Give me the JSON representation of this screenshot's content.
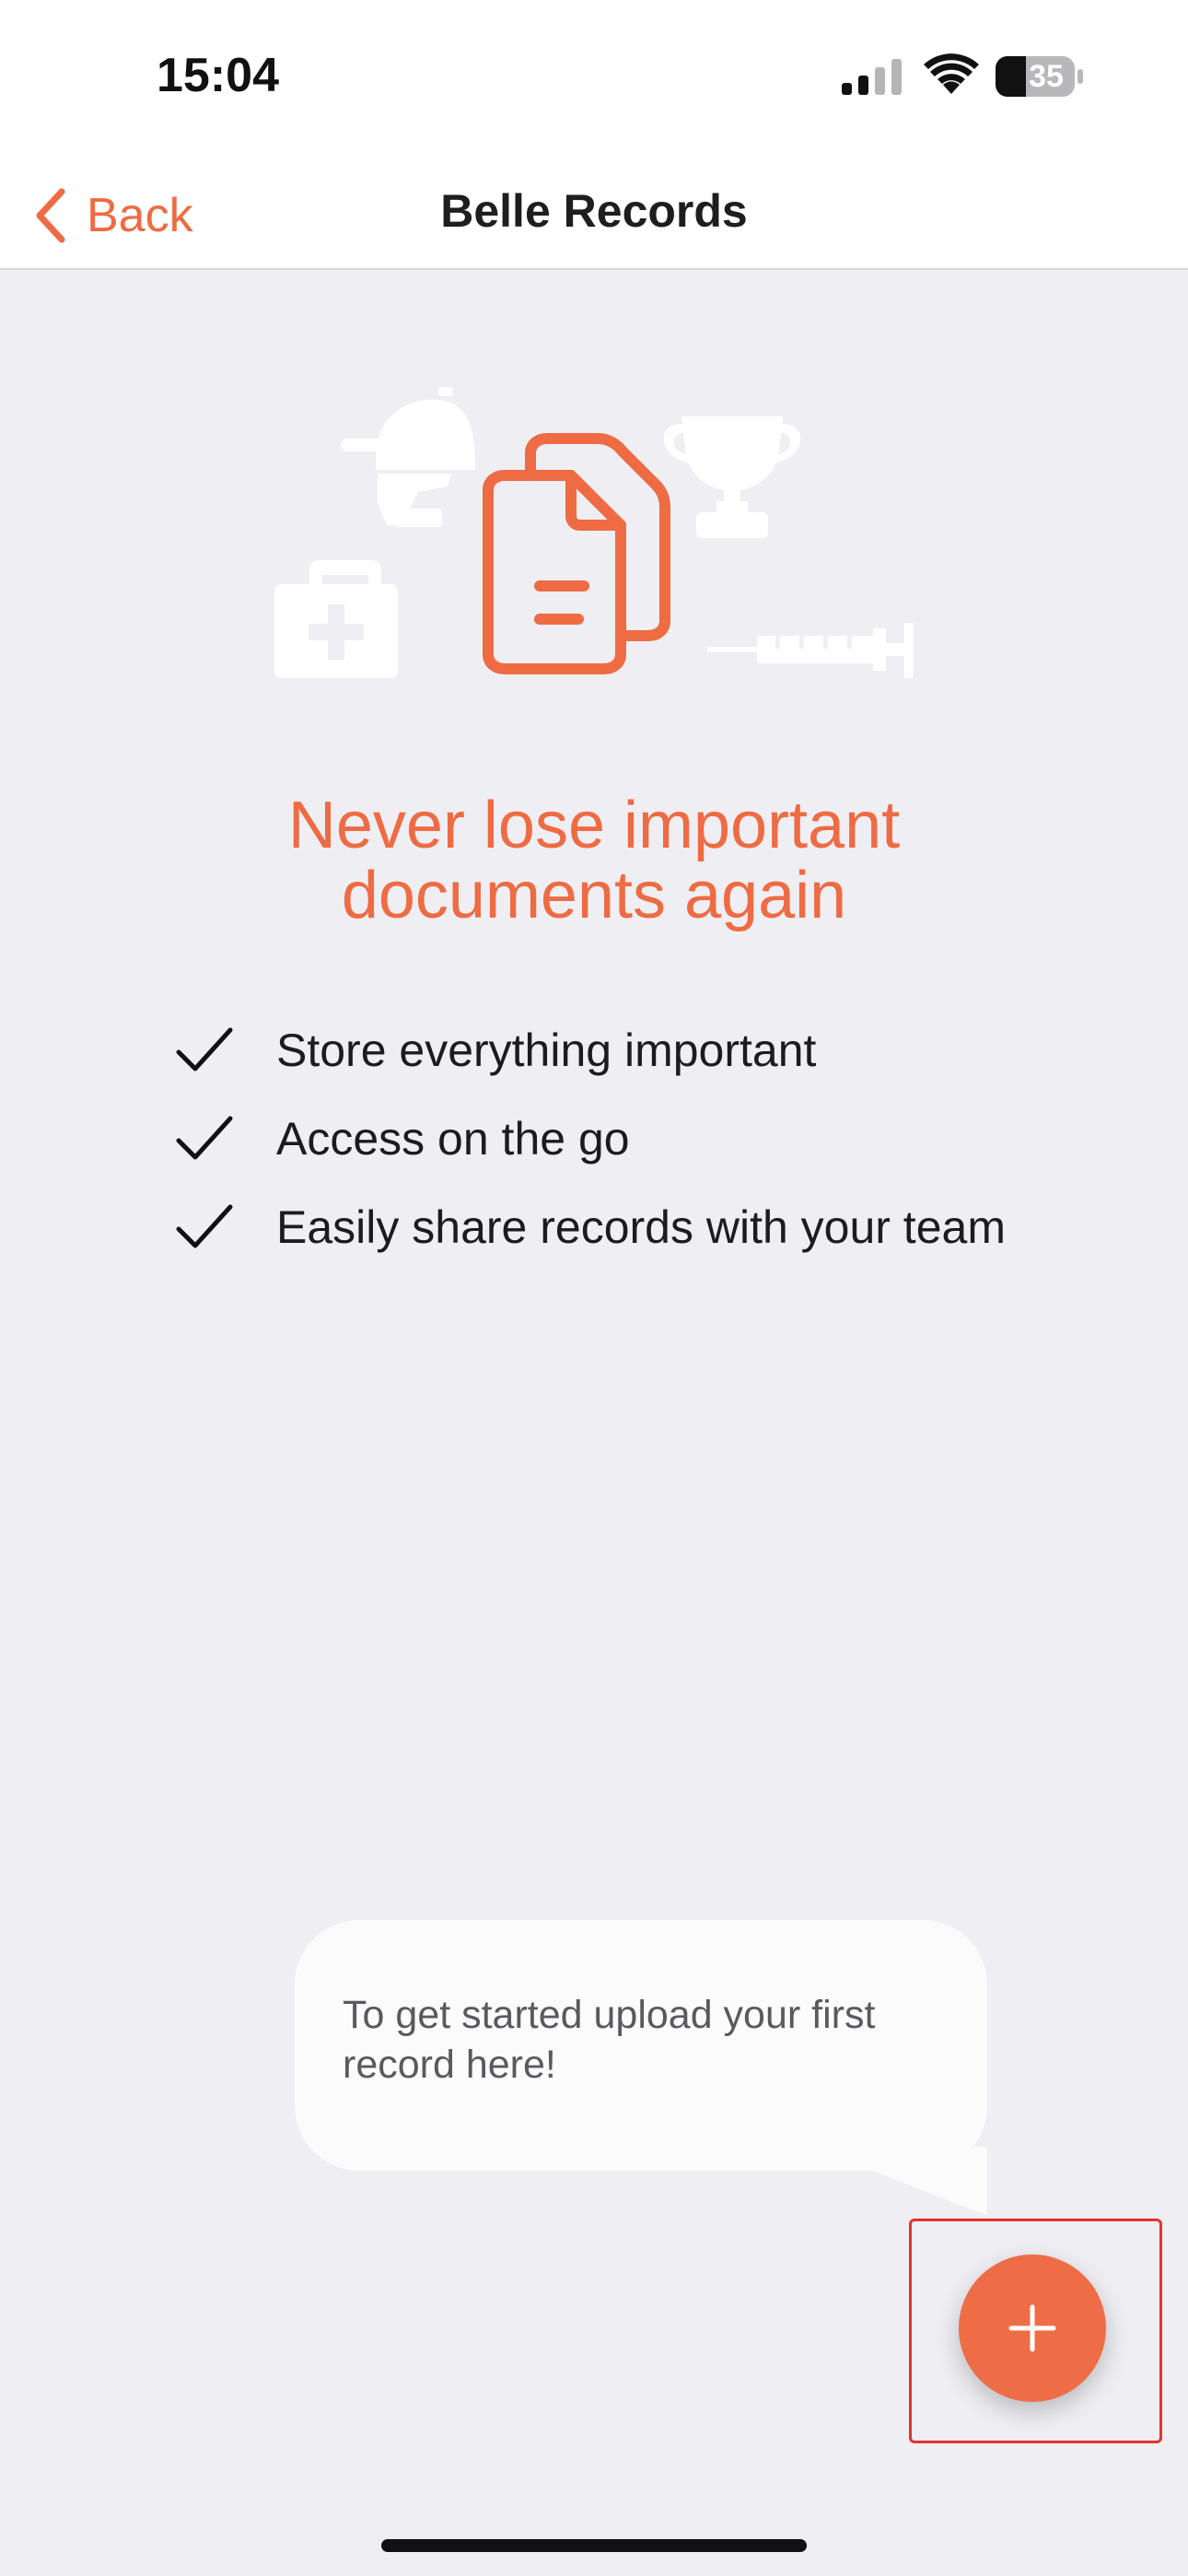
{
  "status_bar": {
    "time": "15:04",
    "battery_level": "35",
    "icons": [
      "cellular-signal-icon",
      "wifi-icon",
      "battery-icon"
    ]
  },
  "nav": {
    "back_label": "Back",
    "title": "Belle Records",
    "back_icon": "chevron-left-icon"
  },
  "hero": {
    "icons": [
      "riding-helmet-icon",
      "trophy-icon",
      "first-aid-kit-icon",
      "documents-icon",
      "syringe-icon"
    ]
  },
  "headline": {
    "line1": "Never lose important",
    "line2": "documents again"
  },
  "features": [
    {
      "label": "Store everything important"
    },
    {
      "label": "Access on the go"
    },
    {
      "label": "Easily share records with your team"
    }
  ],
  "tooltip": {
    "text": "To get started upload your first record here!"
  },
  "fab": {
    "icon": "plus-icon"
  },
  "colors": {
    "accent": "#ee6b43",
    "background": "#efeef3",
    "tooltip": "#fbfbfc",
    "highlight": "#e0352b"
  }
}
